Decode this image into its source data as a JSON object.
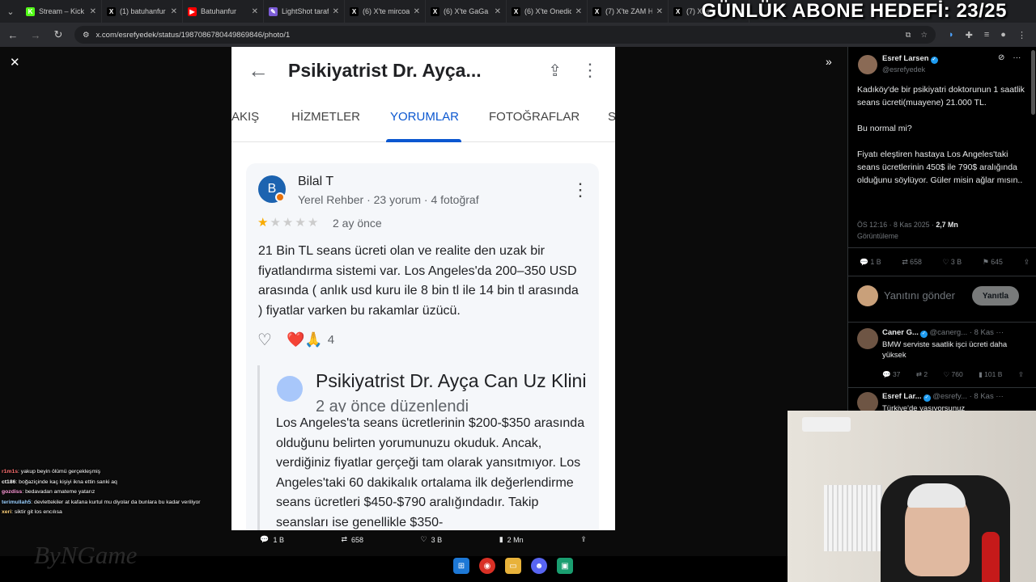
{
  "browser": {
    "tabs": [
      {
        "title": "Stream – Kick",
        "color": "#53fc18",
        "glyph": "K"
      },
      {
        "title": "(1) batuhanfur",
        "color": "#000000",
        "glyph": "X"
      },
      {
        "title": "Batuhanfur",
        "color": "#ff0000",
        "glyph": "▶"
      },
      {
        "title": "LightShot taraf",
        "color": "#7b5cd6",
        "glyph": "✎"
      },
      {
        "title": "(6) X'te mircoa",
        "color": "#000000",
        "glyph": "X"
      },
      {
        "title": "(6) X'te GaGa",
        "color": "#000000",
        "glyph": "X"
      },
      {
        "title": "(6) X'te Onedic",
        "color": "#000000",
        "glyph": "X"
      },
      {
        "title": "(7) X'te ZAM H",
        "color": "#000000",
        "glyph": "X"
      },
      {
        "title": "(7) X'te",
        "color": "#000000",
        "glyph": "X"
      }
    ],
    "url": "x.com/esrefyedek/status/1987086780449869846/photo/1"
  },
  "overlay": {
    "goal": "GÜNLÜK ABONE HEDEFİ: 23/25"
  },
  "photo": {
    "title": "Psikiyatrist Dr. Ayça...",
    "tabs": [
      "AKIŞ",
      "HİZMETLER",
      "YORUMLAR",
      "FOTOĞRAFLAR",
      "S"
    ],
    "review": {
      "avatar_letter": "B",
      "name": "Bilal T",
      "meta": "Yerel Rehber · 23 yorum · 4 fotoğraf",
      "rating": 1,
      "time": "2 ay önce",
      "text": "21 Bin TL seans ücreti olan ve realite den uzak bir fiyatlandırma sistemi var. Los Angeles'da 200–350 USD arasında ( anlık usd kuru ile 8 bin tl ile 14 bin tl arasında ) fiyatlar varken bu rakamlar üzücü.",
      "emoji": "❤️🙏",
      "reaction_count": "4"
    },
    "owner_reply": {
      "name": "Psikiyatrist Dr. Ayça Can Uz Klini",
      "time": "2 ay önce düzenlendi",
      "text": "Los Angeles'ta seans ücretlerinin $200-$350 arasında olduğunu belirten yorumunuzu okuduk. Ancak, verdiğiniz fiyatlar gerçeği tam olarak yansıtmıyor. Los Angeles'taki 60 dakikalık ortalama ilk değerlendirme seans ücretleri $450-$790 aralığındadır. Takip seansları ise genellikle $350-"
    }
  },
  "viewer_stats": {
    "replies": "1 B",
    "reposts": "658",
    "likes": "3 B",
    "views": "2 Mn"
  },
  "tweet": {
    "author": "Esref Larsen",
    "handle": "@esrefyedek",
    "text": "Kadıköy'de bir psikiyatri doktorunun 1 saatlik seans ücreti(muayene) 21.000 TL.\n\nBu normal mi?\n\nFiyatı eleştiren hastaya Los Angeles'taki seans ücretlerinin 450$ ile 790$ aralığında olduğunu söylüyor. Güler misin ağlar mısın..",
    "time": "ÖS 12:16 · 8 Kas 2025 · ",
    "views_count": "2,7 Mn",
    "views_label": "Görüntüleme",
    "replies": "1 B",
    "reposts": "658",
    "likes": "3 B",
    "bookmarks": "645",
    "reply_placeholder": "Yanıtını gönder",
    "reply_button": "Yanıtla"
  },
  "replies": [
    {
      "name": "Caner G...",
      "handle": "@canerg...",
      "date": "· 8 Kas",
      "text": "BMW serviste saatlik işci ücreti daha yüksek",
      "replies": "37",
      "reposts": "2",
      "likes": "760",
      "views": "101 B"
    },
    {
      "name": "Esref Lar...",
      "handle": "@esrefy...",
      "date": "· 8 Kas",
      "text": "Türkiye'de yaşıyorsunuz"
    }
  ],
  "chat": [
    {
      "user": "r1m1s",
      "color": "#ff7070",
      "msg": ": yakup beyin ölümü gerçekleşmiş"
    },
    {
      "user": "ct186",
      "color": "#ffffff",
      "msg": ": boğaziçinde kaç kişiyi ikna ettin sanki aq"
    },
    {
      "user": "gozdiss",
      "color": "#ff9ad9",
      "msg": ": bedavadan amateme yatarız"
    },
    {
      "user": "terimullah5",
      "color": "#9ad0ff",
      "msg": ": devlettekiler at kafana kurtul mu diyolar da bunlara bu kadar veriliyor"
    },
    {
      "user": "xeri",
      "color": "#ffd27a",
      "msg": ": siktir git los encılısa"
    }
  ],
  "watermark": "ByNGame"
}
